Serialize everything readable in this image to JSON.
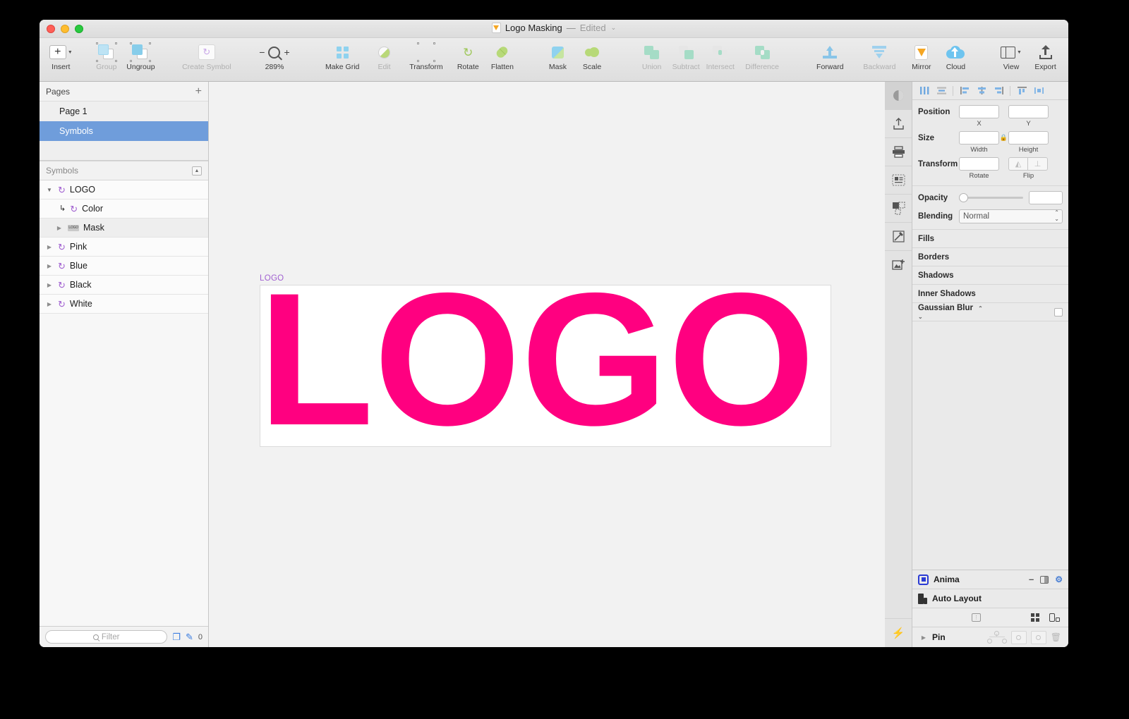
{
  "window": {
    "title": "Logo Masking",
    "title_separator": "—",
    "edited_label": "Edited",
    "chevron": "⌄"
  },
  "toolbar": {
    "items": [
      {
        "label": "Insert",
        "icon": "insert-plus-icon",
        "dim": false
      },
      {
        "label": "Group",
        "icon": "group-icon",
        "dim": true
      },
      {
        "label": "Ungroup",
        "icon": "ungroup-icon",
        "dim": false
      },
      {
        "label": "Create Symbol",
        "icon": "create-symbol-icon",
        "dim": true
      },
      {
        "label": "Make Grid",
        "icon": "make-grid-icon",
        "dim": false
      },
      {
        "label": "Edit",
        "icon": "edit-icon",
        "dim": true
      },
      {
        "label": "Transform",
        "icon": "transform-icon",
        "dim": false
      },
      {
        "label": "Rotate",
        "icon": "rotate-icon",
        "dim": false
      },
      {
        "label": "Flatten",
        "icon": "flatten-icon",
        "dim": false
      },
      {
        "label": "Mask",
        "icon": "mask-icon",
        "dim": false
      },
      {
        "label": "Scale",
        "icon": "scale-icon",
        "dim": false
      },
      {
        "label": "Union",
        "icon": "union-icon",
        "dim": true
      },
      {
        "label": "Subtract",
        "icon": "subtract-icon",
        "dim": true
      },
      {
        "label": "Intersect",
        "icon": "intersect-icon",
        "dim": true
      },
      {
        "label": "Difference",
        "icon": "difference-icon",
        "dim": true
      },
      {
        "label": "Forward",
        "icon": "forward-icon",
        "dim": false
      },
      {
        "label": "Backward",
        "icon": "backward-icon",
        "dim": true
      },
      {
        "label": "Mirror",
        "icon": "mirror-icon",
        "dim": false
      },
      {
        "label": "Cloud",
        "icon": "cloud-icon",
        "dim": false
      },
      {
        "label": "View",
        "icon": "view-icon",
        "dim": false
      },
      {
        "label": "Export",
        "icon": "export-icon",
        "dim": false
      }
    ],
    "zoom": {
      "minus": "−",
      "plus": "+",
      "level": "289%"
    }
  },
  "pages_panel": {
    "header": "Pages",
    "add_button": "+",
    "items": [
      {
        "label": "Page 1",
        "selected": false
      },
      {
        "label": "Symbols",
        "selected": true
      }
    ]
  },
  "layers_panel": {
    "header": "Symbols",
    "collapse_icon": "▲",
    "rows": [
      {
        "name": "LOGO",
        "indent": 0,
        "disclosure": "open",
        "icon": "symbol-icon",
        "shaded": false
      },
      {
        "name": "Color",
        "indent": 1,
        "disclosure": "none",
        "icon": "override-symbol-icon",
        "shaded": false
      },
      {
        "name": "Mask",
        "indent": 1,
        "disclosure": "closed",
        "icon": "mask-thumb-icon",
        "shaded": true,
        "thumb_text": "LOGO"
      },
      {
        "name": "Pink",
        "indent": 0,
        "disclosure": "closed",
        "icon": "symbol-icon",
        "shaded": false
      },
      {
        "name": "Blue",
        "indent": 0,
        "disclosure": "closed",
        "icon": "symbol-icon",
        "shaded": false
      },
      {
        "name": "Black",
        "indent": 0,
        "disclosure": "closed",
        "icon": "symbol-icon",
        "shaded": false
      },
      {
        "name": "White",
        "indent": 0,
        "disclosure": "closed",
        "icon": "symbol-icon",
        "shaded": false
      }
    ]
  },
  "filter_bar": {
    "placeholder": "Filter",
    "count": "0"
  },
  "canvas": {
    "artboard_label": "LOGO",
    "artboard_label_color": "#a05fd0",
    "logo_text": "LOGO",
    "logo_color": "#ff0080",
    "artboard_background": "#ffffff"
  },
  "inspector": {
    "align_buttons": [
      "align-left-icon",
      "align-center-horizontal-icon",
      "align-left-edges-icon",
      "align-center-icon",
      "align-right-edges-icon",
      "align-top-icon",
      "distribute-horizontal-icon"
    ],
    "vertical_tools": [
      "inspector-icon",
      "export-panel-icon",
      "print-icon",
      "text-layout-icon",
      "mask-panel-icon",
      "edit-shape-icon",
      "add-image-icon"
    ],
    "position": {
      "label": "Position",
      "x_value": "",
      "y_value": "",
      "x_sub": "X",
      "y_sub": "Y"
    },
    "size": {
      "label": "Size",
      "width_value": "",
      "height_value": "",
      "width_sub": "Width",
      "height_sub": "Height",
      "lock_icon": "lock-icon"
    },
    "transform": {
      "label": "Transform",
      "rotate_value": "",
      "rotate_sub": "Rotate",
      "flip_sub": "Flip"
    },
    "opacity": {
      "label": "Opacity",
      "value": ""
    },
    "blending": {
      "label": "Blending",
      "value": "Normal"
    },
    "sections": [
      {
        "label": "Fills",
        "checkbox": false,
        "stepper": false
      },
      {
        "label": "Borders",
        "checkbox": false,
        "stepper": false
      },
      {
        "label": "Shadows",
        "checkbox": false,
        "stepper": false
      },
      {
        "label": "Inner Shadows",
        "checkbox": false,
        "stepper": false
      },
      {
        "label": "Gaussian Blur",
        "checkbox": true,
        "stepper": true
      }
    ]
  },
  "anima": {
    "title": "Anima",
    "minimize": "–",
    "panel_icon": "panel-toggle-icon",
    "gear_icon": "gear-icon",
    "auto_layout": "Auto Layout",
    "pin": "Pin",
    "tools": [
      "folder-icon",
      "grid-dots-icon",
      "device-icon"
    ],
    "bolt_icon": "bolt-icon",
    "trash_icon": "trash-icon"
  }
}
